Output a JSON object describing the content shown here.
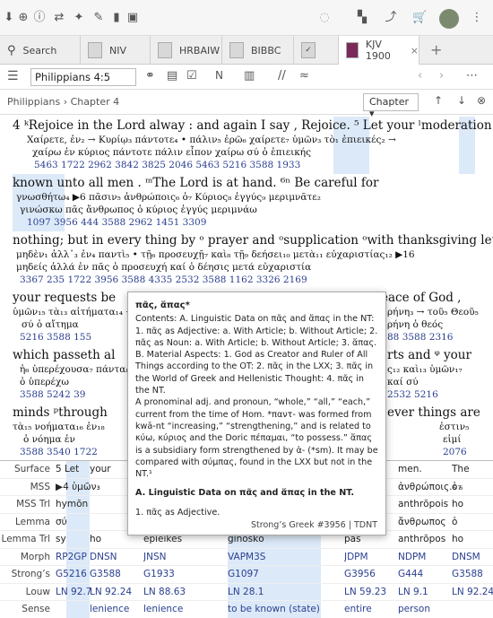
{
  "search_tab": "Search",
  "tabs": [
    {
      "label": "NIV"
    },
    {
      "label": "HRBAIW"
    },
    {
      "label": "BIBBC"
    },
    {
      "label": ""
    },
    {
      "label": "KJV 1900"
    }
  ],
  "reference": "Philippians 4:5",
  "breadcrumb": "Philippians › Chapter 4",
  "chapter_label": "Chapter",
  "popup": {
    "title": "πᾶς, ἅπας*",
    "body": "Contents: A. Linguistic Data on πᾶς and ἅπας in the NT: 1. πᾶς as Adjective: a. With Article; b. Without Article; 2. πᾶς as Noun: a. With Article; b. Without Article; 3. ἅπας. B. Material Aspects: 1. God as Creator and Ruler of All Things according to the OT: 2. πᾶς in the LXX; 3. πᾶς in the World of Greek and Hellenistic Thought: 4. πᾶς in the NT.",
    "body2": "A pronominal adj. and pronoun, “whole,” “all,” “each,” current from the time of Hom. *παντ- was formed from kwā-nt “increasing,” “strengthening,” and is related to κύω, κύριος and the Doric πέπαμαι, “to possess.” ἅπας is a subsidiary form strengthened by ἁ- (*sm). It may be compared with σύμπας, found in the LXX but not in the NT.¹",
    "section": "A.    Linguistic Data on πᾶς and ἅπας in the NT.",
    "item": "1.     πᾶς as Adjective.",
    "footer": "Strong’s Greek #3956 |   TDNT"
  },
  "line1": {
    "text": "4 ᵏRejoice   in   the  Lord   alway : and again  I   say , Rejoice. ⁵ Let your ˡmoderation  be"
  },
  "line2": {
    "text": "  known   unto   all    men  .  ᵐThe  Lord  is   at   hand.  ⁶ⁿ  Be      careful   for"
  },
  "line3": {
    "text": "nothing;  but   in  every thing by ᵒ  prayer   and ᵒsupplication ᵒwith thanksgiving  let"
  },
  "line4": {
    "text": " your   requests   be"
  },
  "line4r": {
    "text": "eace of   God ,"
  },
  "line5": {
    "text": "which   passeth   al"
  },
  "line5r": {
    "text": "rts  and  ᵠ  your"
  },
  "line6": {
    "text": "  minds   ᵖthrough"
  },
  "line6r": {
    "text": "ever things   are"
  },
  "grid": {
    "labels": [
      "Surface",
      "MSS",
      "MSS Trl",
      "Lemma",
      "Lemma Trl",
      "Morph",
      "Strong’s",
      "Louw",
      "Sense"
    ],
    "rows": [
      [
        "5  Let",
        "your",
        "",
        "",
        "",
        "men.",
        "The"
      ],
      [
        "▶4  ὑμῶν₃",
        "",
        "",
        "",
        "",
        "ἀνθρώποις.₆ ₆",
        "ὁ₇"
      ],
      [
        "hymōn",
        "",
        "",
        "",
        "",
        "anthrōpois",
        "ho"
      ],
      [
        "σύ",
        "",
        "",
        "",
        "",
        "ἄνθρωπος",
        "ὁ"
      ],
      [
        "sy",
        "ho",
        "epieikes",
        "ginōskō",
        "pas",
        "anthrōpos",
        "ho"
      ],
      [
        "RP2GP",
        "DNSN",
        "JNSN",
        "VAPM3S",
        "JDPM",
        "NDPM",
        "DNSM"
      ],
      [
        "G5216",
        "G3588",
        "G1933",
        "G1097",
        "G3956",
        "G444",
        "G3588"
      ],
      [
        "LN 92.7",
        "LN 92.24",
        "LN 88.63",
        "LN 28.1",
        "LN 59.23",
        "LN 9.1",
        "LN 92.24"
      ],
      [
        "",
        "lenience",
        "lenience",
        "to be known (state)",
        "entire",
        "person",
        ""
      ]
    ]
  }
}
